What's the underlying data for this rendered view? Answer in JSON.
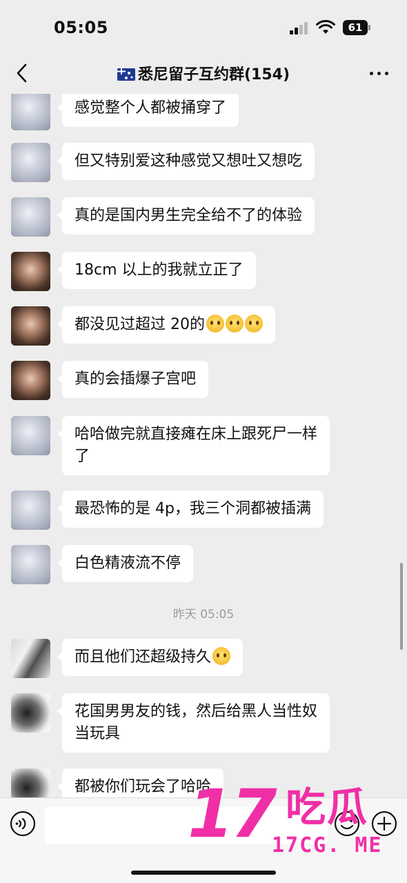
{
  "status": {
    "time": "05:05",
    "battery": "61"
  },
  "nav": {
    "title": "悉尼留子互约群(154)"
  },
  "messages": [
    {
      "avatar": "a",
      "text": "感觉整个人都被捅穿了"
    },
    {
      "avatar": "a",
      "text": "但又特别爱这种感觉又想吐又想吃"
    },
    {
      "avatar": "a",
      "text": "真的是国内男生完全给不了的体验"
    },
    {
      "avatar": "b",
      "text": "18cm 以上的我就立正了"
    },
    {
      "avatar": "b",
      "text": "都没见过超过 20的",
      "emojis": [
        "pleading-face-emoji",
        "pleading-face-emoji",
        "pleading-face-emoji"
      ]
    },
    {
      "avatar": "b",
      "text": "真的会插爆子宫吧"
    },
    {
      "avatar": "a",
      "text": "哈哈做完就直接瘫在床上跟死尸一样\n了"
    },
    {
      "avatar": "a",
      "text": "最恐怖的是 4p，我三个洞都被插满"
    },
    {
      "avatar": "a",
      "text": "白色精液流不停"
    },
    {
      "avatar": "c",
      "text": "而且他们还超级持久",
      "emojis": [
        "rofl-emoji"
      ]
    },
    {
      "avatar": "d",
      "text": "花国男男友的钱，然后给黑人当性奴\n当玩具"
    },
    {
      "avatar": "d",
      "text": "都被你们玩会了哈哈"
    }
  ],
  "divider": {
    "text": "昨天 05:05"
  },
  "watermark": {
    "big": "17",
    "cn": "吃瓜",
    "domain": "17CG. ME"
  },
  "colors": {
    "background": "#ededed",
    "bubble": "#ffffff",
    "watermark": "#f02fa6"
  }
}
